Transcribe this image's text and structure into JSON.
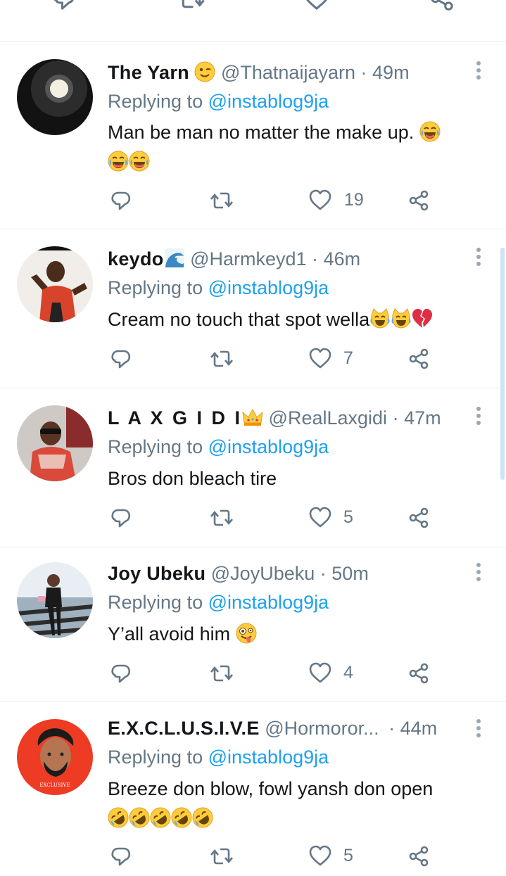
{
  "colors": {
    "name": "#14171a",
    "meta": "#657786",
    "link": "#1da1f2",
    "divider": "#e6ecf0"
  },
  "tweets": [
    {
      "name": "The Yarn",
      "handle": "@Thatnaijayarn",
      "sep": "·",
      "time": "49m",
      "reply_prefix": "Replying to",
      "reply_handle": "@instablog9ja",
      "body": "Man be man no matter the make up.",
      "likes": "19",
      "name_emoji": "winking-face",
      "body_emoji": "tears-of-joy x3"
    },
    {
      "name": "keydo",
      "handle": "@Harmkeyd1",
      "sep": "·",
      "time": "46m",
      "reply_prefix": "Replying to",
      "reply_handle": "@instablog9ja",
      "body": "Cream no touch that spot wella",
      "likes": "7",
      "name_emoji": "water-wave",
      "body_emoji": "cat-tears-of-joy x2, broken-heart"
    },
    {
      "name": "L A X G I D I",
      "handle": "@RealLaxgidi",
      "sep": "·",
      "time": "47m",
      "reply_prefix": "Replying to",
      "reply_handle": "@instablog9ja",
      "body": "Bros don bleach tire",
      "likes": "5",
      "name_emoji": "crown"
    },
    {
      "name": "Joy Ubeku",
      "handle": "@JoyUbeku",
      "sep": "·",
      "time": "50m",
      "reply_prefix": "Replying to",
      "reply_handle": "@instablog9ja",
      "body": "Y’all avoid him",
      "likes": "4",
      "body_emoji": "zany-face"
    },
    {
      "name": "E.X.C.L.U.S.I.V.E",
      "handle": "@Hormoror...",
      "sep": "·",
      "time": "44m",
      "reply_prefix": "Replying to",
      "reply_handle": "@instablog9ja",
      "body": "Breeze don blow, fowl yansh don open",
      "likes": "5",
      "avatar_text": "EXCLUSIVE",
      "body_emoji": "rolling-on-floor-laughing x5"
    }
  ]
}
